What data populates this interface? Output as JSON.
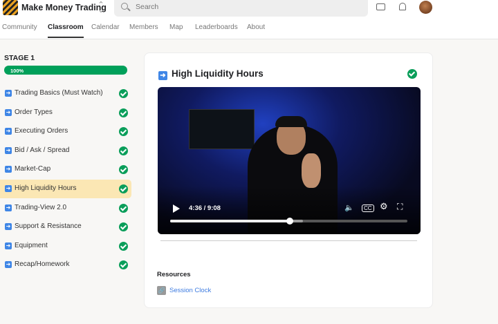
{
  "header": {
    "brand": "Make Money Trading",
    "search_placeholder": "Search"
  },
  "nav": {
    "tabs": [
      {
        "label": "Community"
      },
      {
        "label": "Classroom",
        "active": true
      },
      {
        "label": "Calendar"
      },
      {
        "label": "Members"
      },
      {
        "label": "Map"
      },
      {
        "label": "Leaderboards"
      },
      {
        "label": "About"
      }
    ]
  },
  "sidebar": {
    "stage": "STAGE 1",
    "progress_label": "100%",
    "progress": 100,
    "items": [
      {
        "label": "Trading Basics (Must Watch)"
      },
      {
        "label": "Order Types"
      },
      {
        "label": "Executing Orders"
      },
      {
        "label": "Bid / Ask / Spread"
      },
      {
        "label": "Market-Cap"
      },
      {
        "label": "High Liquidity Hours",
        "selected": true
      },
      {
        "label": "Trading-View 2.0"
      },
      {
        "label": "Support & Resistance"
      },
      {
        "label": "Equipment"
      },
      {
        "label": "Recap/Homework"
      }
    ]
  },
  "lesson": {
    "title": "High Liquidity Hours",
    "completed": true,
    "video": {
      "time": "4:36 / 9:08",
      "played_fraction": 0.504,
      "buffered_fraction": 0.56
    },
    "resources_label": "Resources",
    "resources": [
      {
        "label": "Session Clock"
      }
    ]
  },
  "colors": {
    "accent": "#00a05a",
    "link": "#3d7be0",
    "selected": "#fbe7b4"
  }
}
